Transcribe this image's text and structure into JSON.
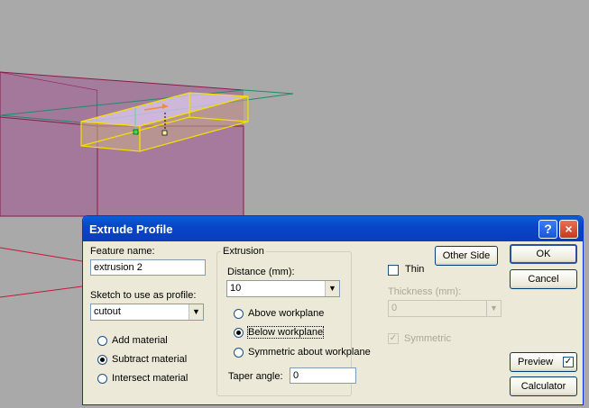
{
  "dialog": {
    "title": "Extrude Profile",
    "help_icon": "?",
    "close_icon": "×",
    "feature_name_label": "Feature name:",
    "feature_name_value": "extrusion 2",
    "sketch_label": "Sketch to use as profile:",
    "sketch_value": "cutout",
    "material_options": [
      "Add material",
      "Subtract material",
      "Intersect material"
    ],
    "material_selected": "Subtract material",
    "extrusion_group_title": "Extrusion",
    "distance_label": "Distance (mm):",
    "distance_value": "10",
    "direction_options": [
      "Above workplane",
      "Below workplane",
      "Symmetric about workplane"
    ],
    "direction_selected": "Below workplane",
    "taper_label": "Taper angle:",
    "taper_value": "0",
    "thin_label": "Thin",
    "thin_checked": false,
    "thickness_label": "Thickness (mm):",
    "thickness_value": "0",
    "symmetric_label": "Symmetric",
    "symmetric_checked": true,
    "other_side_button": "Other Side",
    "ok_button": "OK",
    "cancel_button": "Cancel",
    "preview_button": "Preview",
    "preview_checked": true,
    "calculator_button": "Calculator"
  },
  "colors": {
    "viewport_bg": "#a9a9a9",
    "solid_face": "#a3789a",
    "solid_edge": "#8b1a4a",
    "preview_edge": "#f5e000",
    "preview_fill": "#d8c6e8",
    "workplane_line": "#1c8c6a",
    "title_bar": "#0a46c8",
    "dialog_bg": "#ece9d8"
  }
}
